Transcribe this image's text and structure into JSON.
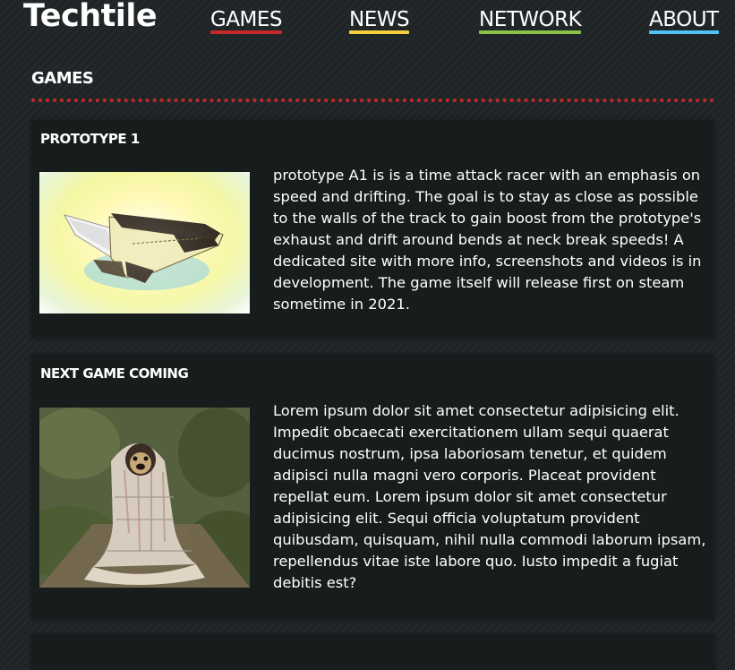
{
  "header": {
    "brand": "Techtile",
    "nav": [
      {
        "label": "GAMES",
        "color": "#c62828"
      },
      {
        "label": "NEWS",
        "color": "#f4d03f"
      },
      {
        "label": "NETWORK",
        "color": "#8bc34a"
      },
      {
        "label": "ABOUT",
        "color": "#4fc3f7"
      }
    ]
  },
  "section": {
    "title": "GAMES",
    "rule_color": "#c62828"
  },
  "cards": [
    {
      "title": "PROTOTYPE 1",
      "image": "prototype-car-render",
      "text": "prototype A1 is is a time attack racer with an emphasis on speed and drifting. The goal is to stay as close as possible to the walls of the track to gain boost from the prototype's exhaust and drift around bends at neck break speeds! A dedicated site with more info, screenshots and videos is in development. The game itself will release first on steam sometime in 2021."
    },
    {
      "title": "NEXT GAME COMING",
      "image": "pug-in-blanket-photo",
      "text": "Lorem ipsum dolor sit amet consectetur adipisicing elit. Impedit obcaecati exercitationem ullam sequi quaerat ducimus nostrum, ipsa laboriosam tenetur, et quidem adipisci nulla magni vero corporis. Placeat provident repellat eum. Lorem ipsum dolor sit amet consectetur adipisicing elit. Sequi officia voluptatum provident quibusdam, quisquam, nihil nulla commodi laborum ipsam, repellendus vitae iste labore quo. Iusto impedit a fugiat debitis est?"
    }
  ]
}
